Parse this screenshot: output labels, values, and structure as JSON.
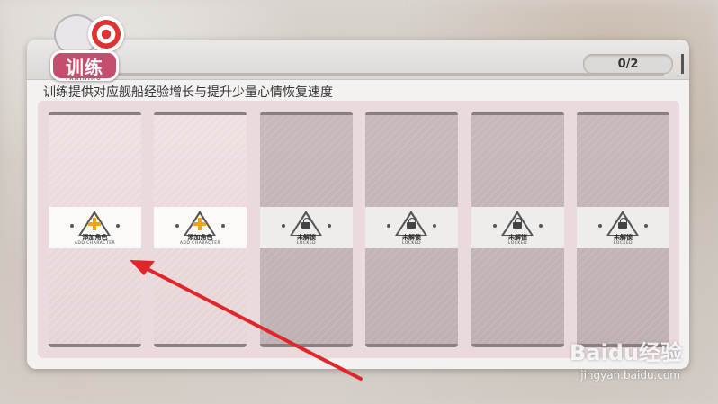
{
  "header": {
    "logo_text": "训练",
    "logo_sub": "TRAINING",
    "counter": "0/2"
  },
  "subtitle": "训练提供对应舰船经验增长与提升少量心情恢复速度",
  "slots": [
    {
      "state": "add",
      "label": "添加角色",
      "label_en": "ADD CHARACTER"
    },
    {
      "state": "add",
      "label": "添加角色",
      "label_en": "ADD CHARACTER"
    },
    {
      "state": "locked",
      "label": "未解锁",
      "label_en": "LOCKED"
    },
    {
      "state": "locked",
      "label": "未解锁",
      "label_en": "LOCKED"
    },
    {
      "state": "locked",
      "label": "未解锁",
      "label_en": "LOCKED"
    },
    {
      "state": "locked",
      "label": "未解锁",
      "label_en": "LOCKED"
    }
  ],
  "watermark": {
    "brand": "Baidu经验",
    "url": "jingyan.baidu.com"
  },
  "colors": {
    "accent_plus": "#f2a21e",
    "arrow": "#e0262b",
    "logo_bubble": "#c54d6d"
  }
}
